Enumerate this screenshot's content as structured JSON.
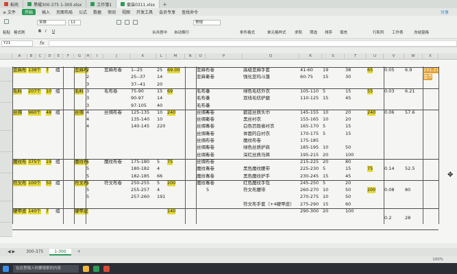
{
  "tabs": [
    {
      "label": "稻壳",
      "active": false,
      "icon": "red"
    },
    {
      "label": "黑曜300-375 1-300.xlsx",
      "active": false,
      "icon": "green"
    },
    {
      "label": "工作簿1",
      "active": false,
      "icon": "green"
    },
    {
      "label": "套装0311.xlsx",
      "active": true,
      "icon": "green"
    }
  ],
  "menu": {
    "items": [
      "≡ 文件",
      "开始",
      "插入",
      "页面布局",
      "公式",
      "数据",
      "审阅",
      "视图",
      "开发工具",
      "会员专享",
      "查找命令"
    ],
    "share": "分享"
  },
  "ribbon": {
    "font_name": "宋体",
    "font_size": "12",
    "number_format": "常规",
    "labels": [
      "格式刷",
      "粘贴",
      "合并居中",
      "自动换行",
      "条件格式",
      "单元格样式",
      "求和",
      "筛选",
      "排序",
      "填充",
      "行和列",
      "工作表",
      "冻结窗格"
    ]
  },
  "formula_bar": {
    "name_box": "Y21",
    "fx": "fx",
    "content": ""
  },
  "columns": [
    "A",
    "B",
    "C",
    "D",
    "E",
    "F",
    "G",
    "H",
    "I",
    "J",
    "K",
    "L",
    "M",
    "N",
    "O",
    "P",
    "Q",
    "R",
    "S",
    "T",
    "U",
    "V",
    "W",
    "X"
  ],
  "table": {
    "blocks": [
      {
        "a": "亚麻布",
        "b": "138",
        "c": "个",
        "d": "7",
        "e": "组",
        "g": "亚麻布",
        "rows": [
          {
            "h": "2",
            "j": "亚麻布卷",
            "k": "1--25",
            "l": "25",
            "m": "69.00"
          },
          {
            "h": "2",
            "k": "25--37",
            "l": "14"
          },
          {
            "h": "3",
            "k": "37--41",
            "l": "20"
          }
        ]
      },
      {
        "a": "毛料",
        "b": "207",
        "c": "个",
        "d": "10",
        "e": "组",
        "g": "毛料",
        "rows": [
          {
            "h": "3",
            "j": "毛布卷",
            "k": "75-90",
            "l": "15",
            "m": "69"
          },
          {
            "h": "3",
            "k": "90-97",
            "l": "14"
          },
          {
            "h": "3",
            "k": "97-105",
            "l": "40"
          }
        ]
      },
      {
        "a": "丝绸",
        "b": "960",
        "c": "个",
        "d": "48",
        "e": "组",
        "g": "丝绸",
        "rows": [
          {
            "h": "4",
            "j": "丝绸布卷",
            "k": "125-135",
            "l": "10",
            "m": "240"
          },
          {
            "h": "4",
            "k": "135-140",
            "l": "10"
          },
          {
            "h": "4",
            "k": "140-145",
            "l": "220"
          }
        ]
      },
      {
        "a": "魔纹布",
        "b": "375",
        "c": "个",
        "d": "19",
        "e": "组",
        "g": "魔纹布",
        "rows": [
          {
            "h": "5",
            "j": "魔纹布卷",
            "k": "175-180",
            "l": "5",
            "m": "75"
          },
          {
            "h": "5",
            "k": "180-182",
            "l": "4"
          },
          {
            "h": "5",
            "k": "182-185",
            "l": "66"
          }
        ]
      },
      {
        "a": "符文布",
        "b": "1000",
        "c": "个",
        "d": "50",
        "e": "组",
        "g": "符文布",
        "rows": [
          {
            "h": "5",
            "j": "符文布卷",
            "k": "250-255",
            "l": "5",
            "m": "200"
          },
          {
            "h": "5",
            "k": "255-257",
            "l": "4"
          },
          {
            "h": "5",
            "k": "257-260",
            "l": "191"
          }
        ]
      },
      {
        "a": "硬甲皮",
        "b": "140",
        "c": "个",
        "d": "7",
        "e": "组",
        "g": "硬甲皮",
        "rows": [
          {
            "m": "140"
          }
        ]
      }
    ],
    "right_rows": [
      {
        "o": "亚麻布卷",
        "q": "高级亚麻手套",
        "r": "41-60",
        "s": "19",
        "t": "38",
        "u": "65",
        "v": "0.05",
        "w": "6.9",
        "x": "231.21",
        "x2": "金币"
      },
      {
        "o": "亚麻布卷",
        "p": "2",
        "q": "强化亚玛斗篷",
        "r": "60-75",
        "s": "15",
        "t": "30"
      },
      {},
      {
        "o": "毛布卷",
        "p": "3",
        "q": "绿色毛纺外衣",
        "r": "105-110",
        "s": "5",
        "t": "15",
        "u": "55",
        "v": "0.03",
        "w": "6.21"
      },
      {
        "o": "毛布卷",
        "p": "3",
        "q": "双线毛纺护腿",
        "r": "110-125",
        "s": "15",
        "t": "45"
      },
      {
        "o": "毛布卷",
        "p": "3"
      },
      {
        "o": "丝绸布卷",
        "p": "4",
        "q": "碧蓝丝质头巾",
        "r": "145-155",
        "s": "10",
        "t": "20",
        "u": "240",
        "v": "0.06",
        "w": "57.6"
      },
      {
        "o": "丝绸布卷",
        "p": "2",
        "q": "黑丝衬衣",
        "r": "155-165",
        "s": "10",
        "t": "20"
      },
      {
        "o": "丝绸布卷",
        "p": "3",
        "q": "白色罚隐者衬衣",
        "r": "165-170",
        "s": "5",
        "t": "15"
      },
      {
        "o": "丝绸布卷",
        "p": "3",
        "q": "体面的白衬衣",
        "r": "170-175",
        "s": "5",
        "t": "15"
      },
      {
        "o": "丝绸布卷",
        "q": "魔纹布卷",
        "r": "175-185"
      },
      {
        "o": "丝绸布卷",
        "p": "5",
        "q": "绿色丝质护肩",
        "r": "185-195",
        "s": "10",
        "t": "50"
      },
      {
        "o": "丝绸布卷",
        "p": "5",
        "q": "深红丝质马裤",
        "r": "195-215",
        "s": "20",
        "t": "100"
      },
      {
        "o": "丝绸布卷",
        "q": "",
        "r": "215-225",
        "s": "20",
        "t": "80"
      },
      {
        "o": "魔纹布卷",
        "p": "3",
        "q": "黑色魔纹腰带",
        "r": "225-230",
        "s": "5",
        "t": "15",
        "u": "75",
        "v": "0.14",
        "w": "52.5"
      },
      {
        "o": "魔纹布卷",
        "p": "3",
        "q": "黑色魔纹护手",
        "r": "230-245",
        "s": "15",
        "t": "45"
      },
      {
        "o": "魔纹布卷",
        "p": "3",
        "q": "红色魔纹手包",
        "r": "245-250",
        "s": "5",
        "t": "20"
      },
      {
        "o": "",
        "p": "5",
        "q": "符文布腰带",
        "r": "260-270",
        "s": "10",
        "t": "50",
        "u": "200",
        "v": "0.08",
        "w": "80"
      },
      {
        "o": "",
        "q": "",
        "r": "270-275",
        "s": "10",
        "t": "50"
      },
      {
        "o": "",
        "q": "符文布手套（+4硬甲皮）",
        "r": "275-290",
        "s": "15",
        "t": "60"
      },
      {
        "o": "",
        "q": "",
        "r": "290-300",
        "s": "20",
        "t": "100"
      },
      {
        "v": "0.2",
        "w": "28"
      }
    ]
  },
  "sheets": [
    "300-375",
    "1-300"
  ],
  "active_sheet": "1-300",
  "status": {
    "left": "",
    "zoom": "100%"
  },
  "taskbar": {
    "search_placeholder": "在这里输入你要搜索的内容"
  },
  "colors": {
    "accent": "#2f9a58",
    "highlight": "#e5d93a",
    "orange": "#e6a233"
  }
}
